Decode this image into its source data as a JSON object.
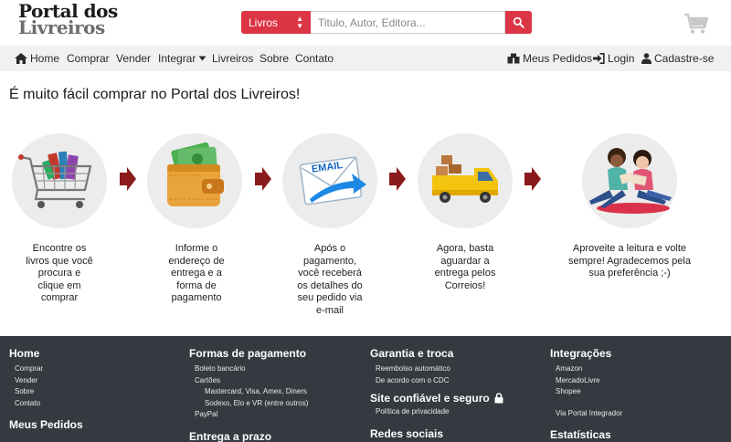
{
  "brand": {
    "line1": "Portal dos",
    "line2": "Livreiros"
  },
  "search": {
    "category": "Livros",
    "placeholder": "Titulo, Autor, Editora..."
  },
  "nav": {
    "left": [
      "Home",
      "Comprar",
      "Vender",
      "Integrar",
      "Livreiros",
      "Sobre",
      "Contato"
    ],
    "right": [
      "Meus Pedidos",
      "Login",
      "Cadastre-se"
    ]
  },
  "headline": "É muito fácil comprar no Portal dos Livreiros!",
  "steps": [
    {
      "lines": [
        "Encontre os",
        "livros que você",
        "procura e",
        "clique em",
        "comprar"
      ]
    },
    {
      "lines": [
        "Informe o",
        "endereço de",
        "entrega e a",
        "forma de",
        "pagamento"
      ]
    },
    {
      "lines": [
        "Após o",
        "pagamento,",
        "você receberá",
        "os detalhes do",
        "seu pedido via",
        "e-mail"
      ]
    },
    {
      "lines": [
        "Agora, basta",
        "aguardar a",
        "entrega pelos",
        "Correios!"
      ]
    },
    {
      "lines": [
        "Aproveite a leitura e volte",
        "sempre! Agradecemos pela",
        "sua preferência ;-)"
      ]
    }
  ],
  "email_label": "EMAIL",
  "footer": {
    "col1": {
      "title": "Home",
      "links": [
        "Comprar",
        "Vender",
        "Sobre",
        "Contato"
      ],
      "title2": "Meus Pedidos"
    },
    "col2": {
      "title": "Formas de pagamento",
      "links": [
        "Boleto bancário",
        "Cartões"
      ],
      "sublinks": [
        "Mastercard, Visa, Amex, Diners",
        "Sodexo, Elo e VR (entre outros)"
      ],
      "links2": [
        "PayPal"
      ],
      "title2": "Entrega a prazo"
    },
    "col3": {
      "title": "Garantia e troca",
      "links": [
        "Reembolso automático",
        "De acordo com o CDC"
      ],
      "title2": "Site confiável e seguro",
      "links2": [
        "Política de privacidade"
      ],
      "title3": "Redes sociais"
    },
    "col4": {
      "title": "Integrações",
      "links": [
        "Amazon",
        "MercadoLivre",
        "Shopee"
      ],
      "links2": [
        "Via Portal Integrador"
      ],
      "title2": "Estatísticas"
    }
  },
  "colors": {
    "accent": "#dc3545",
    "arrow": "#8b1a1a",
    "footer_bg": "#343a40",
    "nav_bg": "#f1f1f1"
  },
  "icons": [
    "search-icon",
    "cart-icon",
    "home-icon",
    "caret-down-icon",
    "orders-icon",
    "login-icon",
    "user-icon",
    "lock-icon",
    "chevron-right-icon"
  ]
}
